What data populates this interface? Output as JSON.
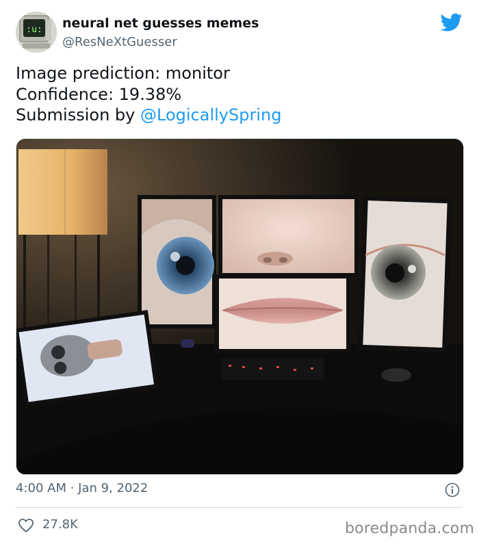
{
  "author": {
    "name": "neural net guesses memes",
    "handle": "@ResNeXtGuesser"
  },
  "tweet": {
    "lines": [
      {
        "text": "Image prediction: monitor"
      },
      {
        "text": "Confidence: 19.38%"
      },
      {
        "prefix": "Submission by ",
        "mention": "@LogicallySpring"
      }
    ]
  },
  "media": {
    "description_icon": "photo-of-six-monitor-desk-setup"
  },
  "meta": {
    "timestamp": "4:00 AM · Jan 9, 2022",
    "like_count": "27.8K"
  },
  "watermark": "boredpanda.com",
  "icons": {
    "brand": "twitter-bird-icon",
    "info": "info-icon",
    "like": "heart-icon"
  },
  "colors": {
    "brand": "#1d9bf0",
    "text": "#0f1419",
    "secondary": "#536471",
    "divider": "#cfd9de"
  }
}
